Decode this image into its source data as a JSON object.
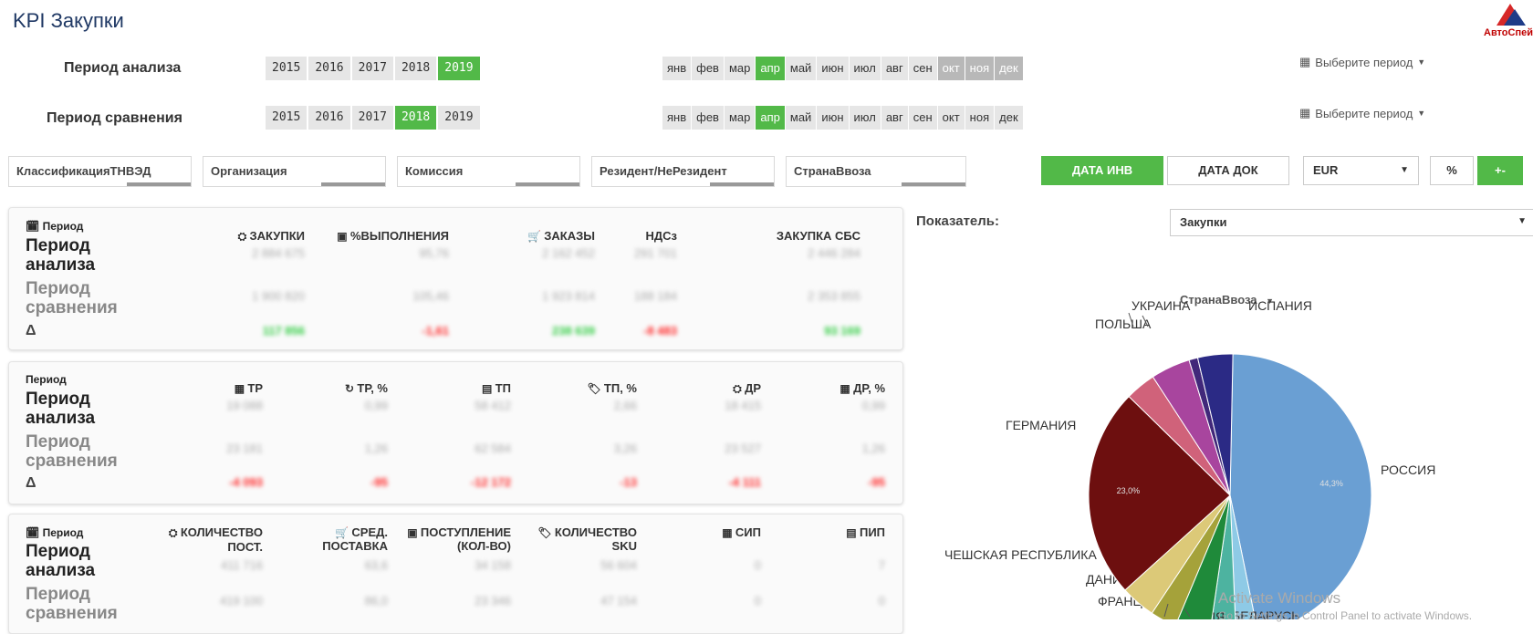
{
  "header": {
    "title": "KPI Закупки",
    "logo_text": "АвтоСпей"
  },
  "period": {
    "analysis_label": "Период анализа",
    "compare_label": "Период сравнения",
    "years": [
      "2015",
      "2016",
      "2017",
      "2018",
      "2019"
    ],
    "analysis_year_selected": "2019",
    "compare_year_selected": "2018",
    "months": [
      "янв",
      "фев",
      "мар",
      "апр",
      "май",
      "июн",
      "июл",
      "авг",
      "сен",
      "окт",
      "ноя",
      "дек"
    ],
    "selected_month": "апр",
    "choose_period": "Выберите период"
  },
  "filters": [
    "КлассификацияТНВЭД",
    "Организация",
    "Комиссия",
    "Резидент/НеРезидент",
    "СтранаВвоза"
  ],
  "buttons": {
    "data_inv": "ДАТА ИНВ",
    "data_doc": "ДАТА ДОК",
    "currency": "EUR",
    "percent": "%",
    "plusminus": "+-"
  },
  "cards": {
    "row_labels": {
      "period": "Период",
      "analysis": "Период анализа",
      "compare": "Период сравнения",
      "delta": "Δ"
    },
    "card1": {
      "headers": [
        "ЗАКУПКИ",
        "%ВЫПОЛНЕНИЯ",
        "ЗАКАЗЫ",
        "НДСз",
        "ЗАКУПКА СБС"
      ],
      "analysis": [
        "2 884 675",
        "95,76",
        "2 162 452",
        "291 701",
        "2 446 284"
      ],
      "compare": [
        "1 900 820",
        "105,46",
        "1 923 814",
        "188 184",
        "2 353 855"
      ],
      "delta": [
        "117 856",
        "-1,61",
        "238 639",
        "-8 483",
        "93 169"
      ]
    },
    "card2": {
      "headers": [
        "ТР",
        "ТР, %",
        "ТП",
        "ТП, %",
        "ДР",
        "ДР, %"
      ],
      "analysis": [
        "19 088",
        "0,99",
        "58 412",
        "2,66",
        "18 415",
        "0,99"
      ],
      "compare": [
        "23 181",
        "1,26",
        "62 584",
        "3,26",
        "23 527",
        "1,26"
      ],
      "delta": [
        "-4 093",
        "-95",
        "-12 172",
        "-13",
        "-4 111",
        "-95"
      ]
    },
    "card3": {
      "headers": [
        "КОЛИЧЕСТВО ПОСТ.",
        "СРЕД. ПОСТАВКА",
        "ПОСТУПЛЕНИЕ (КОЛ-ВО)",
        "КОЛИЧЕСТВО SKU",
        "СИП",
        "ПИП"
      ],
      "analysis": [
        "411 716",
        "63,6",
        "34 158",
        "56 604",
        "0",
        "7"
      ],
      "compare": [
        "419 100",
        "86,0",
        "23 346",
        "47 154",
        "0",
        "0"
      ]
    }
  },
  "indicator": {
    "label": "Показатель:",
    "value": "Закупки",
    "dim_label": "СтранаВвоза"
  },
  "chart_data": {
    "type": "pie",
    "title": "",
    "slices": [
      {
        "label": "РОССИЯ",
        "value": 46.5,
        "color": "#6a9fd3"
      },
      {
        "label": "БЕЛАРУСЬ",
        "value": 2.5,
        "color": "#8ecae6"
      },
      {
        "label": "ИТАЛИЯ",
        "value": 3.0,
        "color": "#4db3a0"
      },
      {
        "label": "ФРАНЦИЯ",
        "value": 4.0,
        "color": "#1f8a3a"
      },
      {
        "label": "ДАНИЯ",
        "value": 3.0,
        "color": "#a5a23a"
      },
      {
        "label": "ЧЕШСКАЯ РЕСПУБЛИКА",
        "value": 4.0,
        "color": "#dcc978"
      },
      {
        "label": "ГЕРМАНИЯ",
        "value": 24.0,
        "color": "#6d0f0f"
      },
      {
        "label": "ПОЛЬША",
        "value": 3.5,
        "color": "#d0627a"
      },
      {
        "label": "УКРАИНА",
        "value": 4.5,
        "color": "#a8459e"
      },
      {
        "label": "ИСПАНИЯ",
        "value": 1.0,
        "color": "#41287a"
      },
      {
        "label": "",
        "value": 4.0,
        "color": "#2b2a85"
      }
    ],
    "slice_numbers": {
      "РОССИЯ": "44,3%",
      "ГЕРМАНИЯ": "23,0%"
    }
  },
  "watermark": {
    "line1": "Activate Windows",
    "line2": "Go to Settings in Control Panel to activate Windows."
  }
}
